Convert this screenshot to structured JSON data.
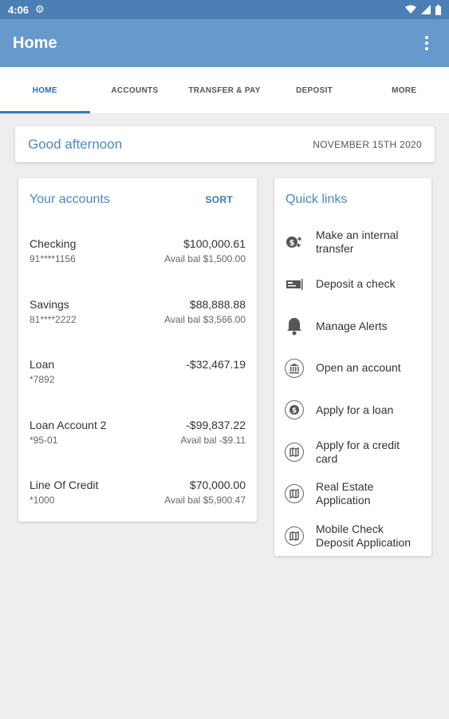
{
  "status": {
    "time": "4:06"
  },
  "appbar": {
    "title": "Home"
  },
  "tabs": [
    "HOME",
    "ACCOUNTS",
    "TRANSFER & PAY",
    "DEPOSIT",
    "MORE"
  ],
  "greeting": {
    "text": "Good afternoon",
    "date": "NOVEMBER 15TH 2020"
  },
  "accounts": {
    "title": "Your accounts",
    "sort_label": "SORT",
    "items": [
      {
        "name": "Checking",
        "number": "91****1156",
        "balance": "$100,000.61",
        "avail": "Avail bal $1,500.00"
      },
      {
        "name": "Savings",
        "number": "81****2222",
        "balance": "$88,888.88",
        "avail": "Avail bal $3,566.00"
      },
      {
        "name": "Loan",
        "number": "*7892",
        "balance": "-$32,467.19",
        "avail": ""
      },
      {
        "name": "Loan Account 2",
        "number": "*95-01",
        "balance": "-$99,837.22",
        "avail": "Avail bal -$9.11"
      },
      {
        "name": "Line Of Credit",
        "number": "*1000",
        "balance": "$70,000.00",
        "avail": "Avail bal $5,900.47"
      }
    ]
  },
  "quick_links": {
    "title": "Quick links",
    "items": [
      {
        "label": "Make an internal transfer",
        "icon": "transfer-icon"
      },
      {
        "label": "Deposit a check",
        "icon": "check-icon"
      },
      {
        "label": "Manage Alerts",
        "icon": "bell-icon"
      },
      {
        "label": "Open an account",
        "icon": "bank-icon"
      },
      {
        "label": "Apply for a loan",
        "icon": "dollar-circle-icon"
      },
      {
        "label": "Apply for a credit card",
        "icon": "map-icon"
      },
      {
        "label": "Real Estate Application",
        "icon": "map-icon"
      },
      {
        "label": "Mobile Check Deposit Application",
        "icon": "map-icon"
      }
    ]
  },
  "colors": {
    "status_bar": "#4c7fb6",
    "app_bar": "#6699cc",
    "accent": "#3b78bf",
    "link_text": "#4a88c7"
  }
}
